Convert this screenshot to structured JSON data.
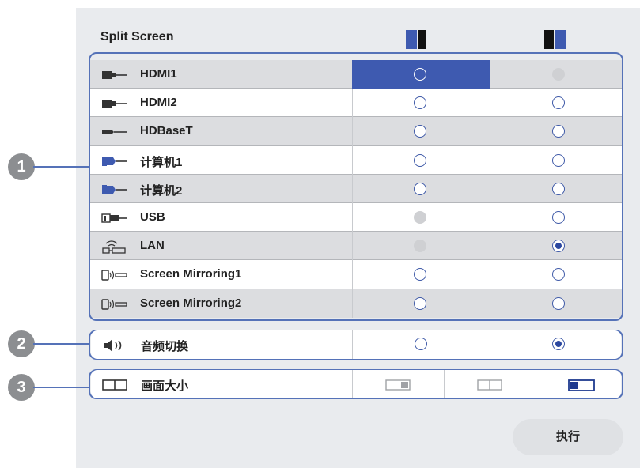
{
  "header": {
    "title": "Split Screen",
    "left_layout_icon": "split-left-active-icon",
    "right_layout_icon": "split-right-active-icon"
  },
  "callouts": [
    "1",
    "2",
    "3"
  ],
  "sources": [
    {
      "label": "HDMI1",
      "icon": "hdmi-icon",
      "left": "selected",
      "right": "disabled"
    },
    {
      "label": "HDMI2",
      "icon": "hdmi-icon",
      "left": "empty",
      "right": "empty"
    },
    {
      "label": "HDBaseT",
      "icon": "hdbaset-icon",
      "left": "empty",
      "right": "empty"
    },
    {
      "label": "计算机1",
      "icon": "computer-icon",
      "left": "empty",
      "right": "empty"
    },
    {
      "label": "计算机2",
      "icon": "computer-icon",
      "left": "empty",
      "right": "empty"
    },
    {
      "label": "USB",
      "icon": "usb-icon",
      "left": "disabled",
      "right": "empty"
    },
    {
      "label": "LAN",
      "icon": "lan-icon",
      "left": "disabled",
      "right": "checked"
    },
    {
      "label": "Screen Mirroring1",
      "icon": "screen-mirroring-icon",
      "left": "empty",
      "right": "empty"
    },
    {
      "label": "Screen Mirroring2",
      "icon": "screen-mirroring-icon",
      "left": "empty",
      "right": "empty"
    }
  ],
  "audio": {
    "label": "音频切换",
    "icon": "speaker-icon",
    "left": "empty",
    "right": "checked"
  },
  "screen_size": {
    "label": "画面大小",
    "icon": "screen-size-icon",
    "options": [
      "size-left-large-icon",
      "size-equal-icon",
      "size-right-large-icon"
    ],
    "selected_index": 2
  },
  "execute_button": {
    "label": "执行"
  },
  "colors": {
    "accent": "#3e5ab0",
    "frame": "#5572b8",
    "panel": "#e9ebee"
  }
}
